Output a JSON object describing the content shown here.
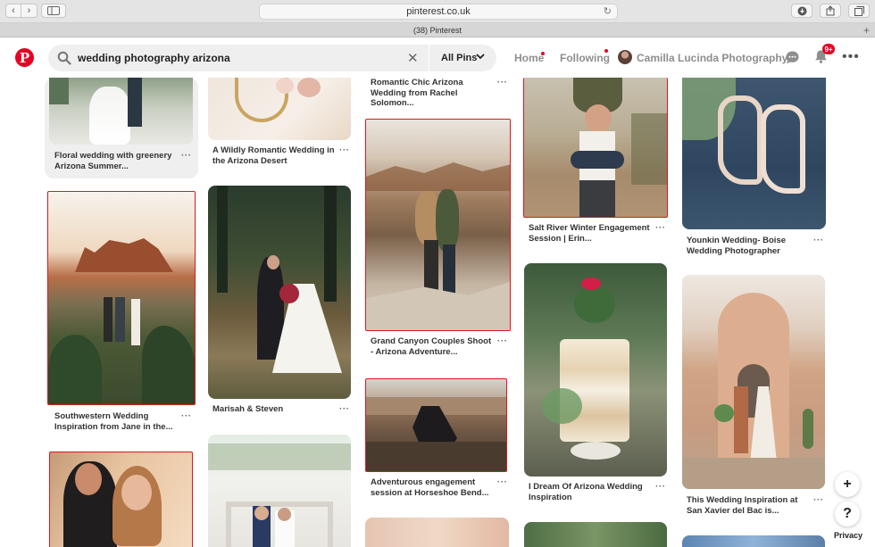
{
  "browser": {
    "url": "pinterest.co.uk",
    "tab_title": "(38) Pinterest"
  },
  "header": {
    "search_query": "wedding photography arizona",
    "filter_label": "All Pins",
    "nav_home": "Home",
    "nav_following": "Following",
    "profile_name": "Camilla Lucinda Photography",
    "notification_count": "9+"
  },
  "pins": [
    {
      "title": "Floral wedding with greenery Arizona Summer...",
      "dots": "···"
    },
    {
      "title": "A Wildly Romantic Wedding in the Arizona Desert",
      "dots": "···"
    },
    {
      "title": "Romantic Chic Arizona Wedding from Rachel Solomon...",
      "dots": "···"
    },
    {
      "title": "Salt River Winter Engagement Session | Erin...",
      "dots": "···"
    },
    {
      "title": "Younkin Wedding- Boise Wedding Photographer",
      "dots": "···"
    },
    {
      "title": "Southwestern Wedding Inspiration from Jane in the...",
      "dots": "···"
    },
    {
      "title": "Marisah & Steven",
      "dots": "···"
    },
    {
      "title": "Grand Canyon Couples Shoot - Arizona Adventure...",
      "dots": "···"
    },
    {
      "title": "I Dream Of Arizona Wedding Inspiration",
      "dots": "···"
    },
    {
      "title": "This Wedding Inspiration at San Xavier del Bac is...",
      "dots": "···"
    },
    {
      "title": "Adventurous engagement session at Horseshoe Bend...",
      "dots": "···"
    }
  ],
  "floating": {
    "add_label": "+",
    "help_label": "?",
    "privacy_label": "Privacy"
  },
  "colors": {
    "brand": "#e60023",
    "annotation_red": "#d8191e"
  }
}
